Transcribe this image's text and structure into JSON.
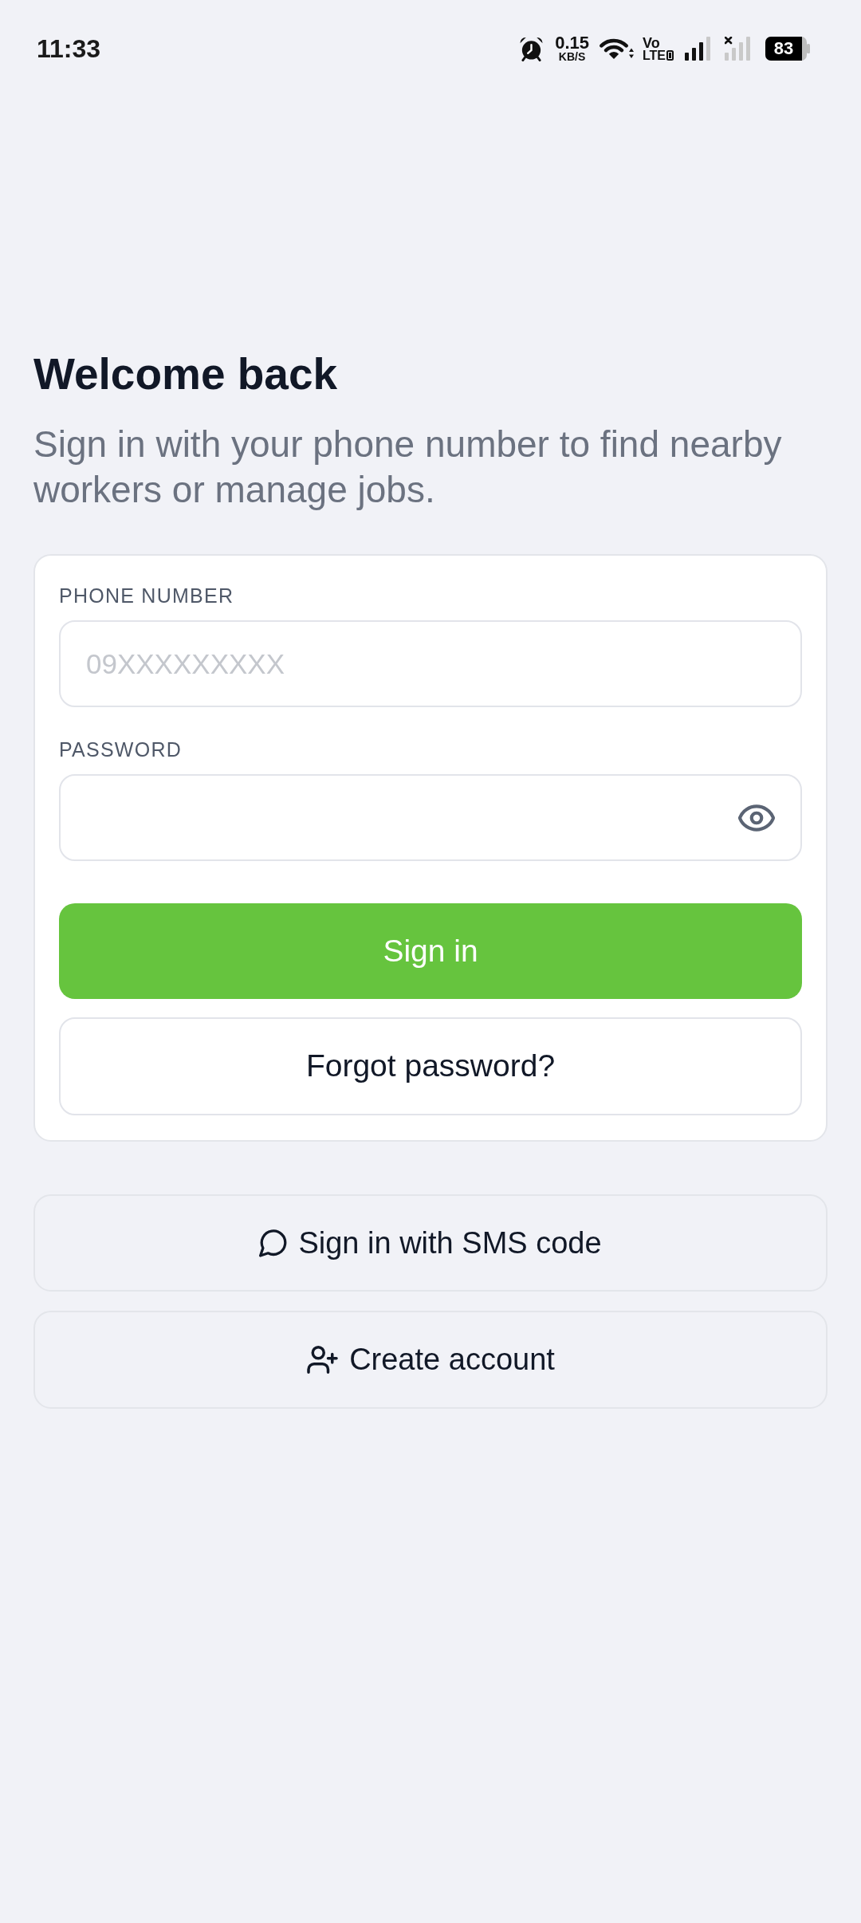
{
  "status_bar": {
    "time": "11:33",
    "data_speed": "0.15",
    "data_unit": "KB/S",
    "network_top": "Vo",
    "network_bottom": "LTE",
    "battery": "83"
  },
  "header": {
    "title": "Welcome back",
    "subtitle": "Sign in with your phone number to find nearby workers or manage jobs."
  },
  "login_card": {
    "fields": [
      {
        "kind": "phone",
        "label": "PHONE NUMBER",
        "placeholder": "09XXXXXXXXX"
      },
      {
        "kind": "password",
        "label": "PASSWORD"
      }
    ],
    "buttons": [
      {
        "kind": "primary",
        "label": "Sign in"
      },
      {
        "kind": "outline",
        "label": "Forgot password?"
      }
    ]
  },
  "other_options": [
    {
      "label": "Sign in with SMS code"
    },
    {
      "label": "Create account"
    }
  ]
}
